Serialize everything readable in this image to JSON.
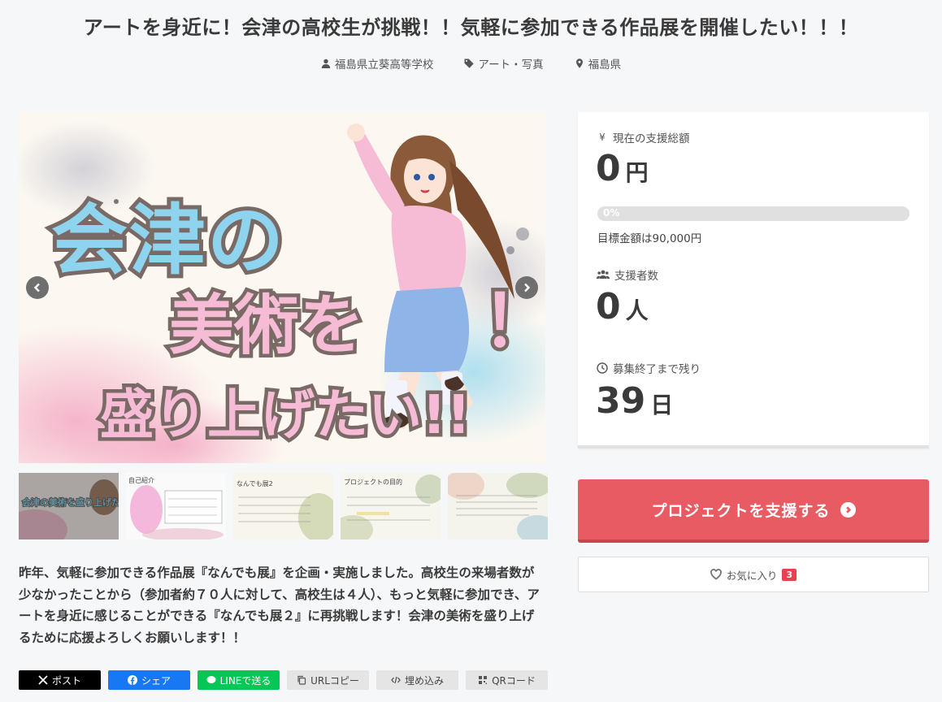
{
  "project": {
    "title": "アートを身近に！会津の高校生が挑戦！！気軽に参加できる作品展を開催したい！！！",
    "owner": "福島県立葵高等学校",
    "category": "アート・写真",
    "location": "福島県"
  },
  "hero": {
    "headline_line1": "会津の",
    "headline_line2": "美術を",
    "headline_line3": "盛り上げたい!!",
    "headline_bang": "！"
  },
  "thumbnails": [
    {
      "label": "会津の美術を盛り上げたい!!",
      "active": true
    },
    {
      "label": "自己紹介",
      "active": false
    },
    {
      "label": "なんでも展2",
      "active": false
    },
    {
      "label": "プロジェクトの目的",
      "active": false
    },
    {
      "label": "",
      "active": false
    }
  ],
  "summary": "昨年、気軽に参加できる作品展『なんでも展』を企画・実施しました。高校生の来場者数が少なかったことから（参加者約７０人に対して、高校生は４人）、もっと気軽に参加でき、アートを身近に感じることができる『なんでも展２』に再挑戦します！会津の美術を盛り上げるために応援よろしくお願いします！！",
  "share": {
    "x": "ポスト",
    "facebook": "シェア",
    "line": "LINEで送る",
    "url_copy": "URLコピー",
    "embed": "埋め込み",
    "qr": "QRコード"
  },
  "stats": {
    "total_label": "現在の支援総額",
    "total_value": "0",
    "total_unit": "円",
    "progress_percent": 0,
    "progress_label": "0%",
    "goal_text": "目標金額は90,000円",
    "supporters_label": "支援者数",
    "supporters_value": "0",
    "supporters_unit": "人",
    "remaining_label": "募集終了まで残り",
    "remaining_value": "39",
    "remaining_unit": "日"
  },
  "actions": {
    "support_label": "プロジェクトを支援する",
    "favorite_label": "お気に入り",
    "favorite_count": "3"
  },
  "colors": {
    "support": "#e85b63",
    "favorite_badge": "#e8414f",
    "x": "#000000",
    "facebook": "#1877f2",
    "line": "#06c755"
  }
}
